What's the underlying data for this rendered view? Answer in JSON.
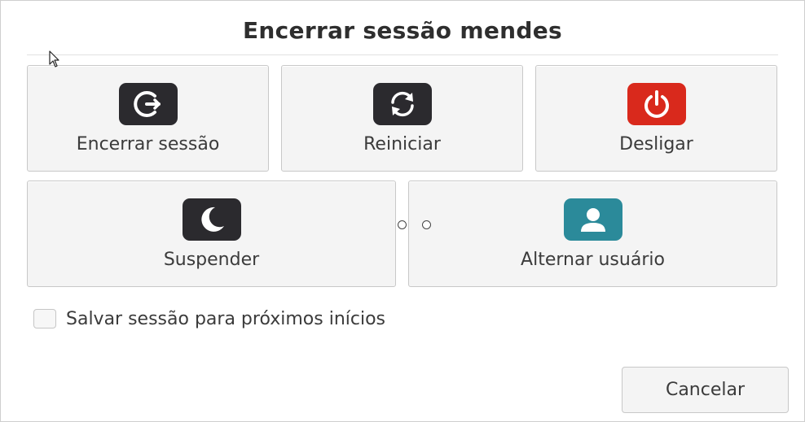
{
  "dialog": {
    "title": "Encerrar sessão mendes"
  },
  "actions": [
    {
      "label": "Encerrar sessão",
      "icon": "logout-icon",
      "color": "#2b2a2e"
    },
    {
      "label": "Reiniciar",
      "icon": "restart-icon",
      "color": "#2b2a2e"
    },
    {
      "label": "Desligar",
      "icon": "power-icon",
      "color": "#d9291c"
    },
    {
      "label": "Suspender",
      "icon": "moon-icon",
      "color": "#2b2a2e"
    },
    {
      "label": "Alternar usuário",
      "icon": "user-icon",
      "color": "#2b8a9a"
    }
  ],
  "save_session": {
    "label": "Salvar sessão para próximos inícios",
    "checked": false
  },
  "footer": {
    "cancel_label": "Cancelar"
  }
}
